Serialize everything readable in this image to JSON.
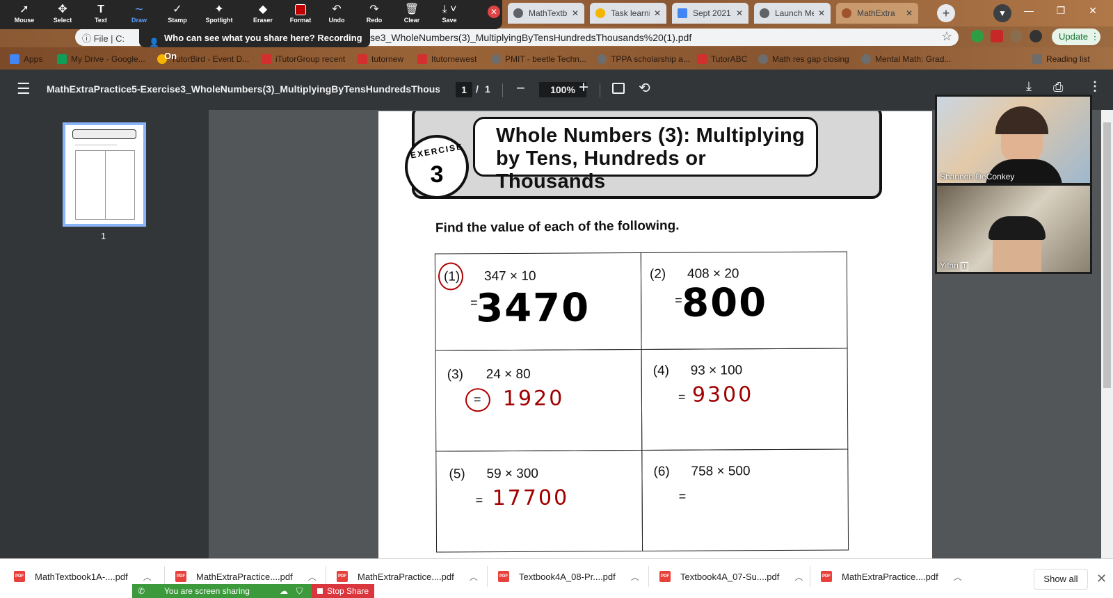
{
  "zoom_toolbar": {
    "tools": [
      {
        "label": "Mouse",
        "icon": "arrow-cursor-icon",
        "glyph": "➚",
        "active": false
      },
      {
        "label": "Select",
        "icon": "move-icon",
        "glyph": "✥",
        "active": false
      },
      {
        "label": "Text",
        "icon": "text-icon",
        "glyph": "T",
        "active": false
      },
      {
        "label": "Draw",
        "icon": "draw-icon",
        "glyph": "∼",
        "active": true
      },
      {
        "label": "Stamp",
        "icon": "check-stamp-icon",
        "glyph": "✓",
        "active": false
      },
      {
        "label": "Spotlight",
        "icon": "spotlight-wand-icon",
        "glyph": "✨",
        "active": false
      },
      {
        "label": "Eraser",
        "icon": "eraser-icon",
        "glyph": "◆",
        "active": false
      },
      {
        "label": "Format",
        "icon": "format-color-icon",
        "glyph": "■",
        "active": false
      },
      {
        "label": "Undo",
        "icon": "undo-icon",
        "glyph": "↶",
        "active": false
      },
      {
        "label": "Redo",
        "icon": "redo-icon",
        "glyph": "↷",
        "active": false
      },
      {
        "label": "Clear",
        "icon": "trash-icon",
        "glyph": "🗑",
        "active": false
      },
      {
        "label": "Save",
        "icon": "save-download-icon",
        "glyph": "⤓",
        "active": false
      }
    ],
    "format_color": "#c00000",
    "active_color": "#5aa0ff",
    "tooltip": "Who can see what you share here? Recording On"
  },
  "browser": {
    "tabs": [
      {
        "label": "MathTextb",
        "fav_color": "#5f6368"
      },
      {
        "label": "Task learni",
        "fav_color": "#f4b400"
      },
      {
        "label": "Sept 2021",
        "fav_color": "#4285f4"
      },
      {
        "label": "Launch Me",
        "fav_color": "#5f6368"
      },
      {
        "label": "MathExtra",
        "fav_color": "#a0522d"
      }
    ],
    "omnibox_prefix": "ⓘ  File  |  C:",
    "url": "se3_WholeNumbers(3)_MultiplyingByTensHundredsThousands%20(1).pdf",
    "update_label": "Update",
    "bookmarks": [
      {
        "label": "Apps",
        "color": "#4285f4"
      },
      {
        "label": "My Drive - Google...",
        "color": "#0f9d58"
      },
      {
        "label": "TutorBird - Event D...",
        "color": "#f4b400"
      },
      {
        "label": "iTutorGroup recent",
        "color": "#d32f2f"
      },
      {
        "label": "tutornew",
        "color": "#d32f2f"
      },
      {
        "label": "Itutornewest",
        "color": "#d32f2f"
      },
      {
        "label": "PMIT - beetle Techn...",
        "color": "#6d6d6d"
      },
      {
        "label": "TPPA scholarship a...",
        "color": "#6d6d6d"
      },
      {
        "label": "TutorABC",
        "color": "#d32f2f"
      },
      {
        "label": "Math res gap closing",
        "color": "#6d6d6d"
      },
      {
        "label": "Mental Math: Grad...",
        "color": "#6d6d6d"
      },
      {
        "label": "Reading list",
        "color": "#6d6d6d"
      }
    ]
  },
  "pdf_viewer": {
    "title": "MathExtraPractice5-Exercise3_WholeNumbers(3)_MultiplyingByTensHundredsThousand...",
    "page_current": "1",
    "page_sep": "/",
    "page_total": "1",
    "zoom": "100%",
    "thumbnail_page": "1"
  },
  "document": {
    "badge_word": "EXERCISE",
    "badge_number": "3",
    "title_line1": "Whole Numbers (3): Multiplying",
    "title_line2": "by Tens, Hundreds or Thousands",
    "instruction": "Find the value of each of the following.",
    "problems": [
      {
        "num": "(1)",
        "expr": "347 × 10",
        "eq": "=",
        "answer": "3470",
        "answer_style": "black"
      },
      {
        "num": "(2)",
        "expr": "408 × 20",
        "eq": "=",
        "answer": "800",
        "answer_style": "black"
      },
      {
        "num": "(3)",
        "expr": "24 × 80",
        "eq": "=",
        "answer": "1920",
        "answer_style": "red"
      },
      {
        "num": "(4)",
        "expr": "93 × 100",
        "eq": "=",
        "answer": "9300",
        "answer_style": "red"
      },
      {
        "num": "(5)",
        "expr": "59 × 300",
        "eq": "=",
        "answer": "17700",
        "answer_style": "red"
      },
      {
        "num": "(6)",
        "expr": "758 × 500",
        "eq": "=",
        "answer": "",
        "answer_style": "red"
      }
    ]
  },
  "video_panel": {
    "participants": [
      {
        "name": "Shannon DeConkey",
        "badge": ""
      },
      {
        "name": "Yifan",
        "badge": "T"
      }
    ]
  },
  "downloads": {
    "items": [
      "MathTextbook1A-....pdf",
      "MathExtraPractice....pdf",
      "MathExtraPractice....pdf",
      "Textbook4A_08-Pr....pdf",
      "Textbook4A_07-Su....pdf",
      "MathExtraPractice....pdf"
    ],
    "show_all": "Show all"
  },
  "share": {
    "sharing_label": "You are screen sharing",
    "stop_label": "Stop Share"
  }
}
